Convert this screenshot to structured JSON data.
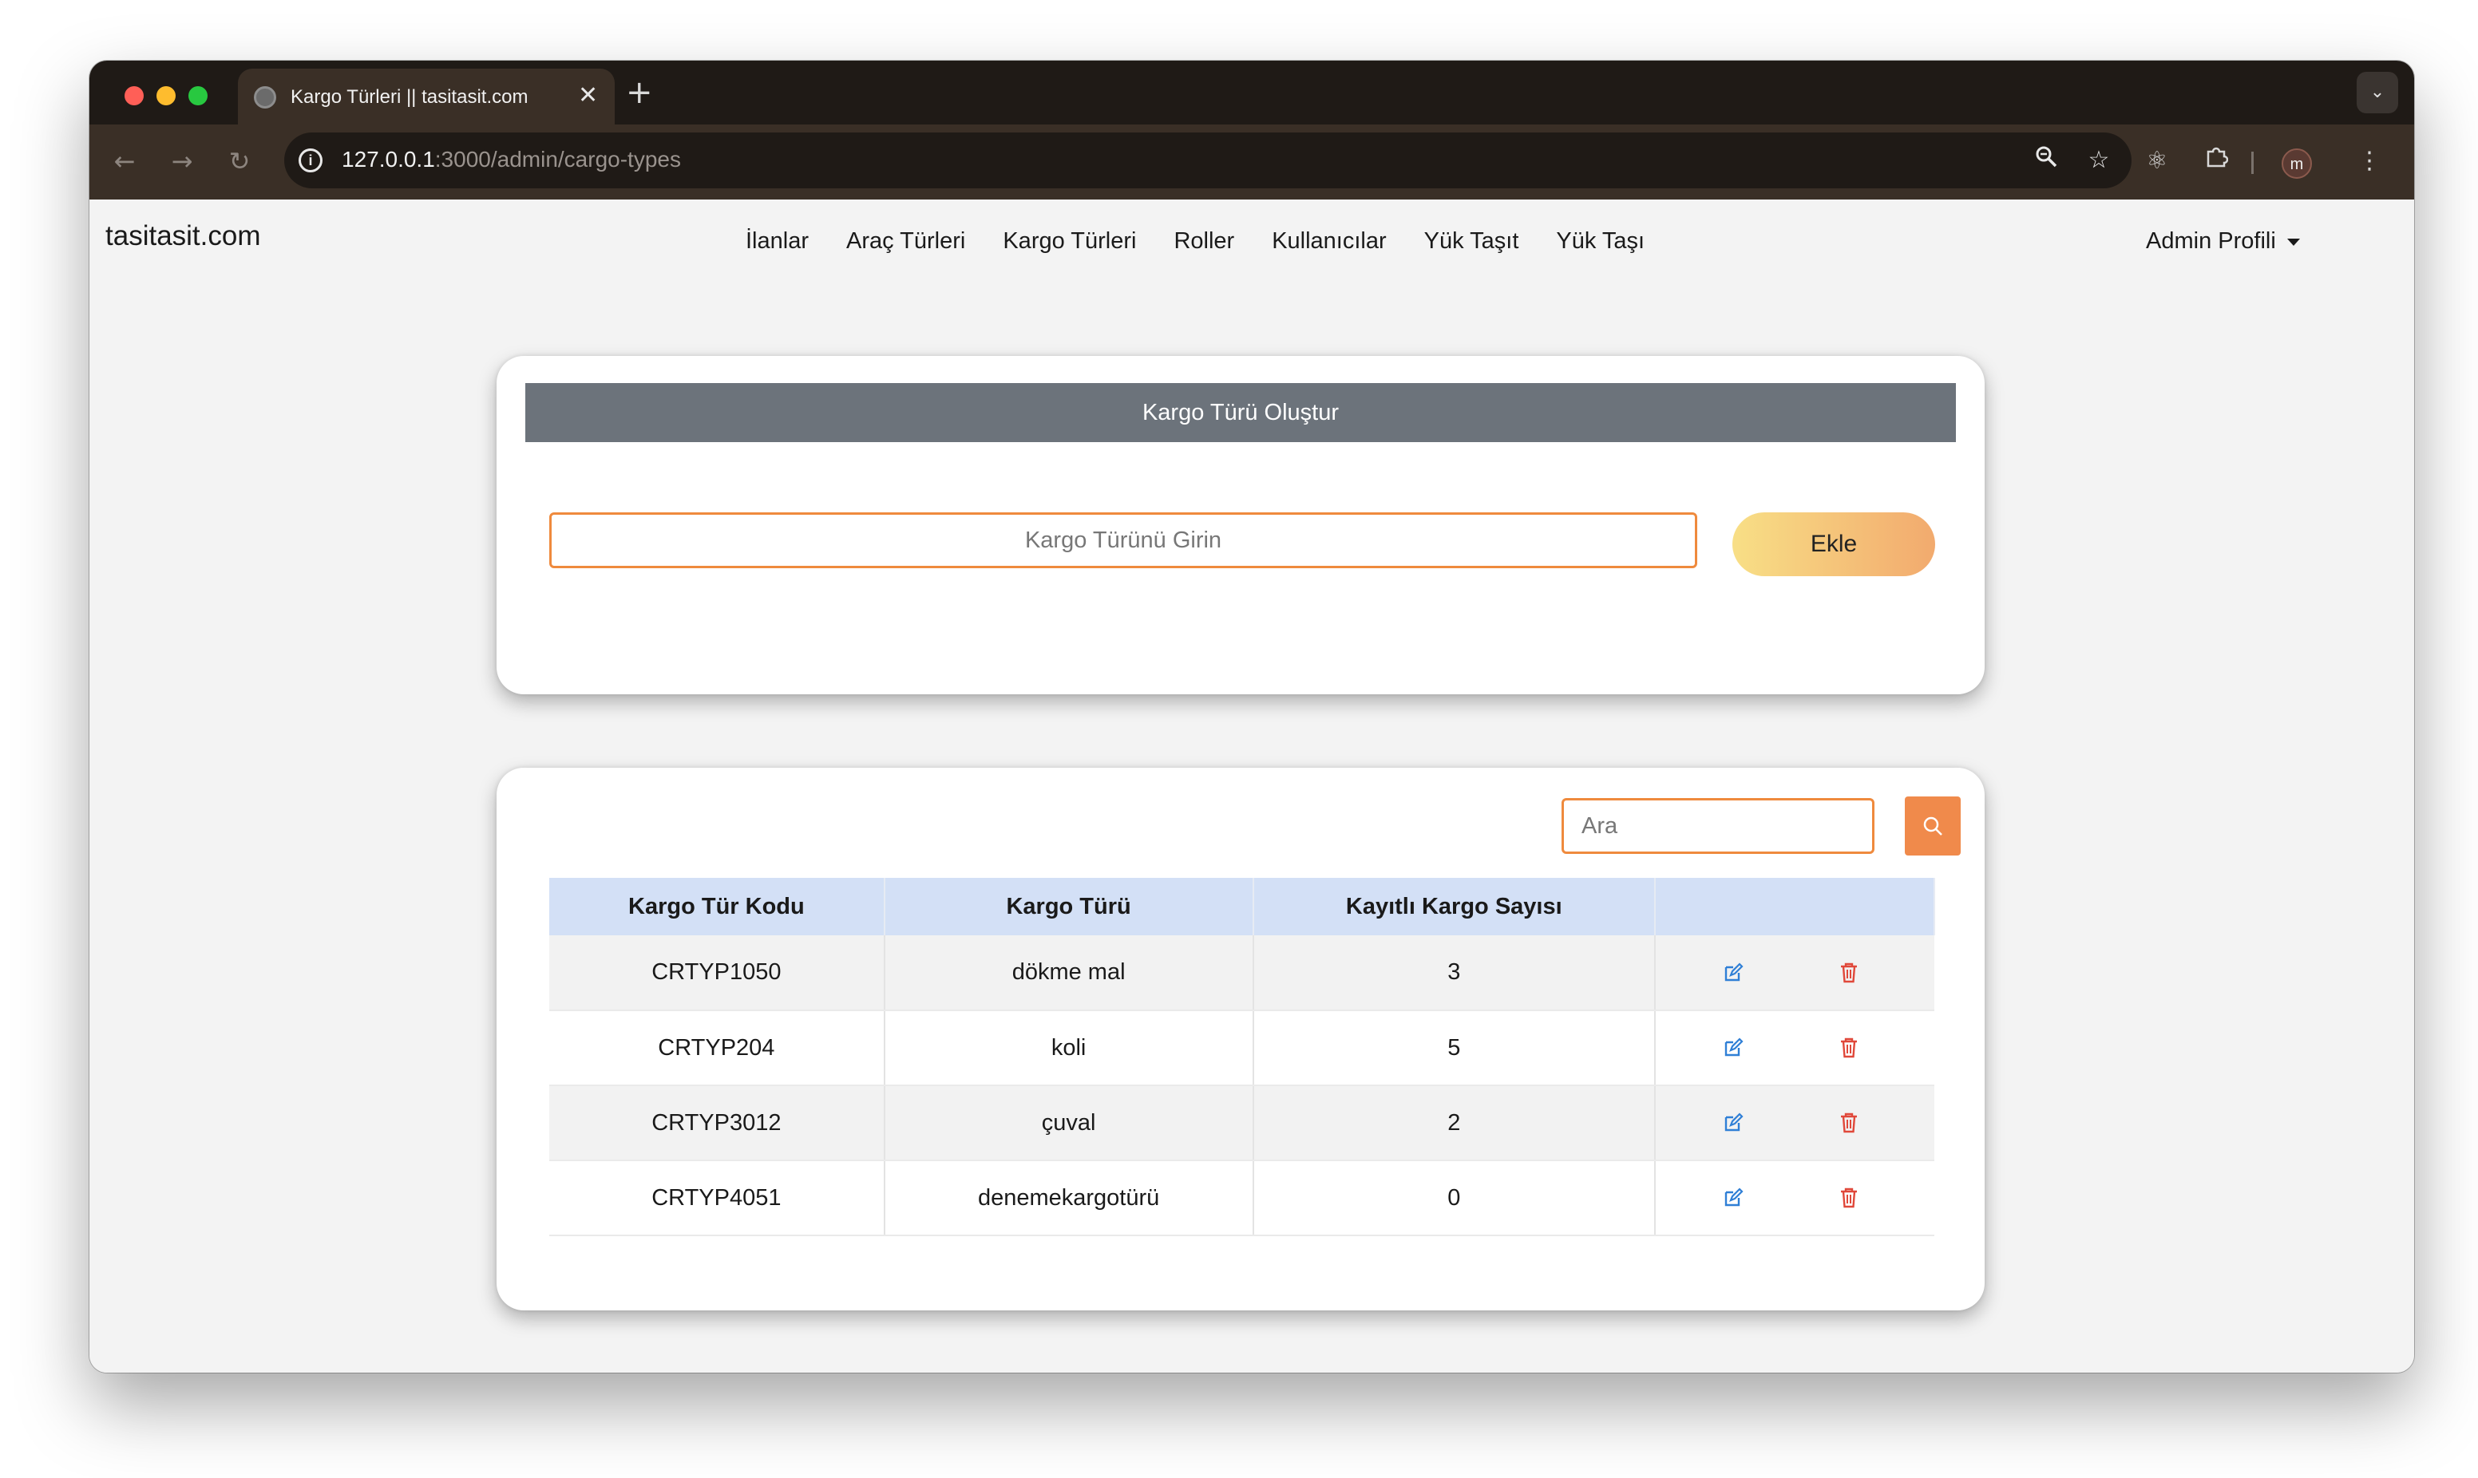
{
  "browser": {
    "tab_title": "Kargo Türleri || tasitasit.com",
    "tab_close": "✕",
    "new_tab": "+",
    "url_host": "127.0.0.1",
    "url_rest": ":3000/admin/cargo-types",
    "profile_initial": "m"
  },
  "navbar": {
    "brand": "tasitasit.com",
    "links": [
      "İlanlar",
      "Araç Türleri",
      "Kargo Türleri",
      "Roller",
      "Kullanıcılar",
      "Yük Taşıt",
      "Yük Taşı"
    ],
    "admin_menu": "Admin Profili"
  },
  "create_card": {
    "title": "Kargo Türü Oluştur",
    "input_placeholder": "Kargo Türünü Girin",
    "add_button": "Ekle"
  },
  "list_card": {
    "search_placeholder": "Ara",
    "columns": [
      "Kargo Tür Kodu",
      "Kargo Türü",
      "Kayıtlı Kargo Sayısı",
      ""
    ],
    "rows": [
      {
        "code": "CRTYP1050",
        "name": "dökme mal",
        "count": "3"
      },
      {
        "code": "CRTYP204",
        "name": "koli",
        "count": "5"
      },
      {
        "code": "CRTYP3012",
        "name": "çuval",
        "count": "2"
      },
      {
        "code": "CRTYP4051",
        "name": "denemekargotürü",
        "count": "0"
      }
    ]
  },
  "colors": {
    "accent_orange": "#ef8a3d",
    "header_gray": "#6c737b",
    "table_head_blue": "#d3e0f6",
    "edit_blue": "#2f7fd6",
    "delete_red": "#e0483a"
  },
  "icons": {
    "edit": "edit-icon",
    "delete": "trash-icon",
    "search": "search-icon"
  }
}
